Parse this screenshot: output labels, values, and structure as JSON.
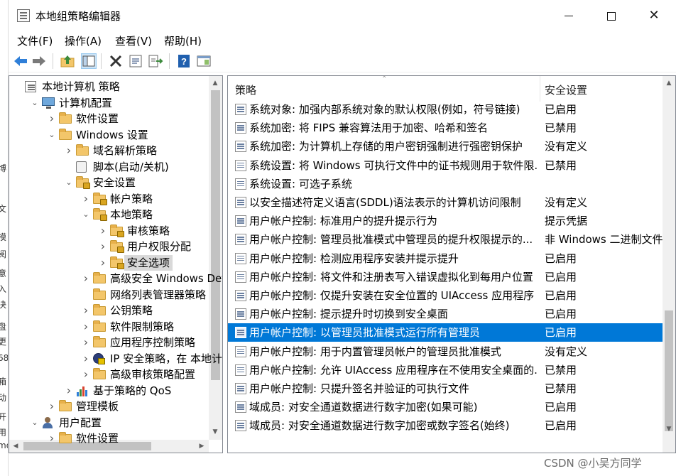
{
  "window": {
    "title": "本地组策略编辑器"
  },
  "background_chars": [
    "博",
    "文",
    "模",
    "阅",
    "意",
    "入",
    "决",
    "盘",
    "更",
    "68",
    "箱",
    "动",
    "开",
    "用",
    "mo"
  ],
  "menu": [
    {
      "label": "文件(F)"
    },
    {
      "label": "操作(A)"
    },
    {
      "label": "查看(V)"
    },
    {
      "label": "帮助(H)"
    }
  ],
  "toolbar": [
    {
      "icon": "back-arrow-icon"
    },
    {
      "icon": "forward-arrow-icon"
    },
    {
      "icon": "up-folder-icon"
    },
    {
      "icon": "show-tree-icon"
    },
    {
      "icon": "delete-icon"
    },
    {
      "icon": "properties-icon"
    },
    {
      "icon": "export-list-icon"
    },
    {
      "icon": "help-icon"
    },
    {
      "icon": "view-pane-icon"
    }
  ],
  "tree": [
    {
      "label": "本地计算机 策略",
      "level": 0,
      "toggle": "",
      "icon": "doc",
      "selected": false
    },
    {
      "label": "计算机配置",
      "level": 1,
      "toggle": "v",
      "icon": "pc",
      "selected": false
    },
    {
      "label": "软件设置",
      "level": 2,
      "toggle": ">",
      "icon": "folder",
      "selected": false
    },
    {
      "label": "Windows 设置",
      "level": 2,
      "toggle": "v",
      "icon": "folder",
      "selected": false
    },
    {
      "label": "域名解析策略",
      "level": 3,
      "toggle": ">",
      "icon": "folder",
      "selected": false
    },
    {
      "label": "脚本(启动/关机)",
      "level": 3,
      "toggle": "",
      "icon": "script",
      "selected": false
    },
    {
      "label": "安全设置",
      "level": 3,
      "toggle": "v",
      "icon": "folder-lock",
      "selected": false
    },
    {
      "label": "帐户策略",
      "level": 4,
      "toggle": ">",
      "icon": "folder-lock",
      "selected": false
    },
    {
      "label": "本地策略",
      "level": 4,
      "toggle": "v",
      "icon": "folder-lock",
      "selected": false
    },
    {
      "label": "审核策略",
      "level": 5,
      "toggle": ">",
      "icon": "folder-lock",
      "selected": false
    },
    {
      "label": "用户权限分配",
      "level": 5,
      "toggle": ">",
      "icon": "folder-lock",
      "selected": false
    },
    {
      "label": "安全选项",
      "level": 5,
      "toggle": ">",
      "icon": "folder-lock",
      "selected": true
    },
    {
      "label": "高级安全 Windows Def",
      "level": 4,
      "toggle": ">",
      "icon": "folder",
      "selected": false
    },
    {
      "label": "网络列表管理器策略",
      "level": 4,
      "toggle": "",
      "icon": "folder",
      "selected": false
    },
    {
      "label": "公钥策略",
      "level": 4,
      "toggle": ">",
      "icon": "folder",
      "selected": false
    },
    {
      "label": "软件限制策略",
      "level": 4,
      "toggle": ">",
      "icon": "folder",
      "selected": false
    },
    {
      "label": "应用程序控制策略",
      "level": 4,
      "toggle": ">",
      "icon": "folder",
      "selected": false
    },
    {
      "label": "IP 安全策略，在 本地计",
      "level": 4,
      "toggle": ">",
      "icon": "ipsec",
      "selected": false
    },
    {
      "label": "高级审核策略配置",
      "level": 4,
      "toggle": ">",
      "icon": "folder",
      "selected": false
    },
    {
      "label": "基于策略的 QoS",
      "level": 3,
      "toggle": ">",
      "icon": "chart",
      "selected": false
    },
    {
      "label": "管理模板",
      "level": 2,
      "toggle": ">",
      "icon": "folder",
      "selected": false
    },
    {
      "label": "用户配置",
      "level": 1,
      "toggle": "v",
      "icon": "user",
      "selected": false
    },
    {
      "label": "软件设置",
      "level": 2,
      "toggle": ">",
      "icon": "folder",
      "selected": false
    }
  ],
  "list": {
    "columns": {
      "policy": "策略",
      "setting": "安全设置"
    },
    "rows": [
      {
        "policy": "系统对象: 加强内部系统对象的默认权限(例如，符号链接)",
        "setting": "已启用",
        "selected": false
      },
      {
        "policy": "系统加密: 将 FIPS 兼容算法用于加密、哈希和签名",
        "setting": "已禁用",
        "selected": false
      },
      {
        "policy": "系统加密: 为计算机上存储的用户密钥强制进行强密钥保护",
        "setting": "没有定义",
        "selected": false
      },
      {
        "policy": "系统设置: 将 Windows 可执行文件中的证书规则用于软件限...",
        "setting": "已禁用",
        "selected": false
      },
      {
        "policy": "系统设置: 可选子系统",
        "setting": "",
        "selected": false
      },
      {
        "policy": "以安全描述符定义语言(SDDL)语法表示的计算机访问限制",
        "setting": "没有定义",
        "selected": false
      },
      {
        "policy": "用户帐户控制: 标准用户的提升提示行为",
        "setting": "提示凭据",
        "selected": false
      },
      {
        "policy": "用户帐户控制: 管理员批准模式中管理员的提升权限提示的...",
        "setting": "非 Windows 二进制文件",
        "selected": false
      },
      {
        "policy": "用户帐户控制: 检测应用程序安装并提示提升",
        "setting": "已启用",
        "selected": false
      },
      {
        "policy": "用户帐户控制: 将文件和注册表写入错误虚拟化到每用户位置",
        "setting": "已启用",
        "selected": false
      },
      {
        "policy": "用户帐户控制: 仅提升安装在安全位置的 UIAccess 应用程序",
        "setting": "已启用",
        "selected": false
      },
      {
        "policy": "用户帐户控制: 提示提升时切换到安全桌面",
        "setting": "已启用",
        "selected": false
      },
      {
        "policy": "用户帐户控制: 以管理员批准模式运行所有管理员",
        "setting": "已启用",
        "selected": true
      },
      {
        "policy": "用户帐户控制: 用于内置管理员帐户的管理员批准模式",
        "setting": "没有定义",
        "selected": false
      },
      {
        "policy": "用户帐户控制: 允许 UIAccess 应用程序在不使用安全桌面的...",
        "setting": "已禁用",
        "selected": false
      },
      {
        "policy": "用户帐户控制: 只提升签名并验证的可执行文件",
        "setting": "已禁用",
        "selected": false
      },
      {
        "policy": "域成员: 对安全通道数据进行数字加密(如果可能)",
        "setting": "已启用",
        "selected": false
      },
      {
        "policy": "域成员: 对安全通道数据进行数字加密或数字签名(始终)",
        "setting": "已启用",
        "selected": false
      }
    ]
  },
  "watermark": "CSDN @小吴方同学",
  "colors": {
    "selection": "#0078d7",
    "tree_selection": "#d9d9d9"
  }
}
